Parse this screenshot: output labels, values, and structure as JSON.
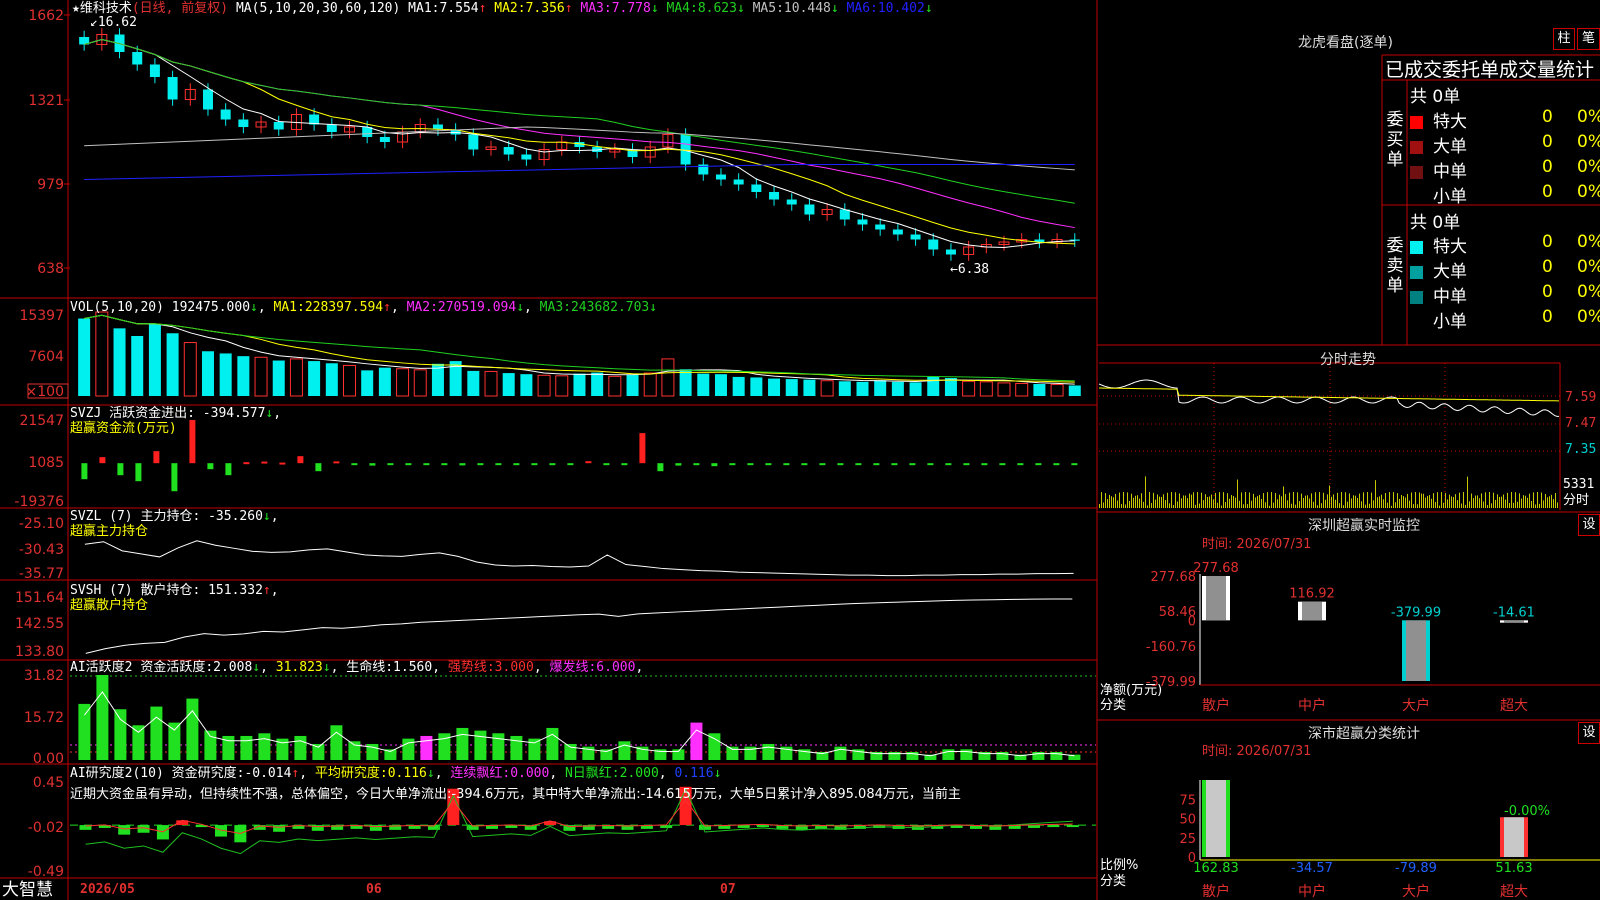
{
  "app": {
    "brand": "大智慧"
  },
  "colors": {
    "up": "#ff3030",
    "down": "#00f0f0",
    "flow_up": "#ff2020",
    "flow_down": "#20e020",
    "ma1": "#ffffff",
    "ma2": "#ffff00",
    "ma3": "#ff30ff",
    "ma4": "#20d020",
    "ma5": "#c0c0c0",
    "ma6": "#2020ff",
    "border": "#c00000"
  },
  "kline": {
    "stock_name": "★维科技术",
    "period": "(日线, 前复权)",
    "ma_params": "MA(5,10,20,30,60,120)",
    "ma": [
      {
        "label": "MA1:",
        "value": "7.554",
        "arrow": "↑"
      },
      {
        "label": "MA2:",
        "value": "7.356",
        "arrow": "↑"
      },
      {
        "label": "MA3:",
        "value": "7.778",
        "arrow": "↓"
      },
      {
        "label": "MA4:",
        "value": "8.623",
        "arrow": "↓"
      },
      {
        "label": "MA5:",
        "value": "10.448",
        "arrow": "↓"
      },
      {
        "label": "MA6:",
        "value": "10.402",
        "arrow": "↓"
      }
    ],
    "y_ticks": [
      "1662",
      "1321",
      "979",
      "638"
    ],
    "high_marker": "16.62",
    "low_marker": "6.38"
  },
  "vol": {
    "title": "VOL(5,10,20)",
    "value": "192475.000",
    "value_arrow": "↓",
    "ma": [
      {
        "label": "MA1:",
        "value": "228397.594",
        "arrow": "↑"
      },
      {
        "label": "MA2:",
        "value": "270519.094",
        "arrow": "↓"
      },
      {
        "label": "MA3:",
        "value": "243682.703",
        "arrow": "↓"
      }
    ],
    "y_ticks": [
      "15397",
      "7604",
      "×100"
    ]
  },
  "svzj": {
    "title": "SVZJ",
    "label": "活跃资金进出:",
    "value": "-394.577",
    "arrow": "↓",
    "subtitle": "超赢资金流(万元)",
    "y_ticks": [
      "21547",
      "1085",
      "-19376"
    ]
  },
  "svzl": {
    "title": "SVZL (7)",
    "label": "主力持仓:",
    "value": "-35.260",
    "arrow": "↓",
    "subtitle": "超赢主力持仓",
    "y_ticks": [
      "-25.10",
      "-30.43",
      "-35.77"
    ]
  },
  "svsh": {
    "title": "SVSH (7)",
    "label": "散户持仓:",
    "value": "151.332",
    "arrow": "↑",
    "subtitle": "超赢散户持仓",
    "y_ticks": [
      "151.64",
      "142.55",
      "133.80"
    ]
  },
  "ai_active": {
    "title": "AI活跃度2",
    "items": [
      {
        "label": "资金活跃度:",
        "value": "2.008",
        "arrow": "↓"
      },
      {
        "label": "",
        "value": "31.823",
        "arrow": "↓"
      },
      {
        "label": "生命线:",
        "value": "1.560",
        "arrow": ""
      },
      {
        "label": "强势线:",
        "value": "3.000",
        "arrow": ""
      },
      {
        "label": "爆发线:",
        "value": "6.000",
        "arrow": ""
      }
    ],
    "y_ticks": [
      "31.82",
      "15.72",
      "0.00"
    ]
  },
  "ai_research": {
    "title": "AI研究度2(10)",
    "items": [
      {
        "label": "资金研究度:",
        "value": "-0.014",
        "arrow": "↑"
      },
      {
        "label": "平均研究度:",
        "value": "0.116",
        "arrow": "↓"
      },
      {
        "label": "连续飘红:",
        "value": "0.000",
        "arrow": ""
      },
      {
        "label": "N日飘红:",
        "value": "2.000",
        "arrow": ""
      },
      {
        "label": "",
        "value": "0.116",
        "arrow": "↓"
      }
    ],
    "commentary": "近期大资金虽有异动，但持续性不强，总体偏空，今日大单净流出:-394.6万元，其中特大单净流出:-14.615万元，大单5日累计净入895.084万元，当前主",
    "y_ticks": [
      "0.45",
      "-0.02",
      "-0.49"
    ]
  },
  "date_axis": [
    "2026/05",
    "06",
    "07"
  ],
  "dragon_tiger": {
    "title": "龙虎看盘(逐单)",
    "buttons": [
      "柱",
      "笔"
    ],
    "header": "已成交委托单成交量统计",
    "buy": {
      "side_label": "委买单",
      "total": "共 0单",
      "rows": [
        {
          "name": "特大",
          "count": "0",
          "pct": "0%",
          "color": "#ff0000"
        },
        {
          "name": "大单",
          "count": "0",
          "pct": "0%",
          "color": "#a01010"
        },
        {
          "name": "中单",
          "count": "0",
          "pct": "0%",
          "color": "#701010"
        },
        {
          "name": "小单",
          "count": "0",
          "pct": "0%",
          "color": "#000000"
        }
      ]
    },
    "sell": {
      "side_label": "委卖单",
      "total": "共 0单",
      "rows": [
        {
          "name": "特大",
          "count": "0",
          "pct": "0%",
          "color": "#00f0f0"
        },
        {
          "name": "大单",
          "count": "0",
          "pct": "0%",
          "color": "#00a0a0"
        },
        {
          "name": "中单",
          "count": "0",
          "pct": "0%",
          "color": "#008080"
        },
        {
          "name": "小单",
          "count": "0",
          "pct": "0%",
          "color": "#000000"
        }
      ]
    }
  },
  "intraday": {
    "title": "分时走势",
    "y_ticks": [
      "7.59",
      "7.47",
      "7.35"
    ],
    "vol_tick": "5331",
    "vol_label": "分时"
  },
  "monitor": {
    "title": "深圳超赢实时监控",
    "settings": "设",
    "time": "时间: 2026/07/31",
    "axis_label_1": "净额(万元)",
    "axis_label_2": "分类",
    "y_ticks": [
      "277.68",
      "58.46",
      "0",
      "-160.76",
      "-379.99"
    ],
    "bars": [
      {
        "category": "散户",
        "value": 277.68,
        "label": "277.68"
      },
      {
        "category": "中户",
        "value": 116.92,
        "label": "116.92"
      },
      {
        "category": "大户",
        "value": -379.99,
        "label": "-379.99"
      },
      {
        "category": "超大",
        "value": -14.61,
        "label": "-14.61"
      }
    ]
  },
  "classify": {
    "title": "深市超赢分类统计",
    "settings": "设",
    "time": "时间: 2026/07/31",
    "axis_label_1": "比例%",
    "axis_label_2": "分类",
    "y_ticks": [
      "75",
      "50",
      "25",
      "0"
    ],
    "bars": [
      {
        "category": "散户",
        "value": 162.83,
        "label": "162.83"
      },
      {
        "category": "中户",
        "value": -34.57,
        "label": "-34.57"
      },
      {
        "category": "大户",
        "value": -79.89,
        "label": "-79.89"
      },
      {
        "category": "超大",
        "value": 51.63,
        "label": "51.63"
      }
    ],
    "top_label": "-0.00%"
  },
  "chart_data": [
    {
      "type": "candlestick",
      "title": "★维科技术 (日线, 前复权)",
      "x_range": [
        "2026/05",
        "2026/07"
      ],
      "ylim": [
        6.38,
        16.62
      ],
      "high": 16.62,
      "low": 6.38,
      "closes": [
        15.4,
        15.8,
        15.1,
        14.6,
        14.1,
        13.2,
        13.6,
        12.8,
        12.4,
        12.1,
        12.3,
        12.0,
        12.6,
        12.2,
        11.9,
        12.1,
        11.7,
        11.5,
        11.9,
        12.2,
        12.0,
        11.8,
        11.2,
        11.3,
        11.0,
        10.8,
        11.2,
        11.5,
        11.3,
        11.1,
        11.2,
        10.9,
        11.3,
        11.8,
        10.6,
        10.2,
        10.0,
        9.8,
        9.5,
        9.2,
        9.0,
        8.6,
        8.8,
        8.4,
        8.2,
        8.0,
        7.8,
        7.6,
        7.2,
        7.0,
        7.3,
        7.4,
        7.5,
        7.6,
        7.5,
        7.6,
        7.55
      ]
    },
    {
      "type": "bar",
      "title": "VOL(5,10,20)",
      "ylim": [
        0,
        15397
      ],
      "values": [
        14200,
        15397,
        12400,
        11000,
        13200,
        11500,
        9800,
        8200,
        7800,
        7300,
        7100,
        6500,
        6800,
        6400,
        6000,
        5600,
        4700,
        5200,
        5000,
        4800,
        5900,
        6400,
        4600,
        4500,
        4200,
        4000,
        3800,
        3700,
        4100,
        4300,
        3600,
        3900,
        4200,
        6800,
        4900,
        4100,
        4000,
        3500,
        3400,
        3200,
        3100,
        3000,
        2800,
        2700,
        2600,
        2900,
        2600,
        2500,
        3500,
        3300,
        2700,
        2600,
        2400,
        2300,
        2200,
        2100,
        1924.75
      ]
    },
    {
      "type": "bar",
      "title": "SVZJ 超赢资金流(万元)",
      "ylim": [
        -19376,
        21547
      ],
      "values": [
        -8000,
        3000,
        -6000,
        -9000,
        6000,
        -14000,
        21547,
        -3000,
        -6000,
        500,
        800,
        300,
        3500,
        -4000,
        900,
        -600,
        -1200,
        -800,
        -1000,
        -700,
        -900,
        -1100,
        -400,
        -700,
        -500,
        -300,
        -800,
        -600,
        1000,
        -500,
        -400,
        15000,
        -4000,
        -1200,
        -900,
        -1500,
        -600,
        -800,
        -700,
        -500,
        -600,
        -400,
        -300,
        -700,
        -500,
        -400,
        -300,
        -200,
        -500,
        -400,
        -300,
        -250,
        -300,
        -350,
        -400,
        -394.577
      ]
    },
    {
      "type": "line",
      "title": "SVZL (7) 超赢主力持仓",
      "ylim": [
        -35.77,
        -25.1
      ],
      "values": [
        -29.5,
        -29.0,
        -30.8,
        -31.4,
        -32.0,
        -30.2,
        -28.8,
        -29.7,
        -30.3,
        -30.9,
        -31.1,
        -31.0,
        -30.6,
        -30.4,
        -31.0,
        -31.6,
        -31.8,
        -31.9,
        -31.5,
        -31.2,
        -31.9,
        -33.0,
        -33.6,
        -33.8,
        -33.7,
        -33.9,
        -34.0,
        -33.8,
        -31.6,
        -33.5,
        -33.9,
        -34.3,
        -34.5,
        -34.7,
        -34.8,
        -35.0,
        -35.1,
        -35.2,
        -35.3,
        -35.4,
        -35.5,
        -35.6,
        -35.6,
        -35.7,
        -35.7,
        -35.6,
        -35.6,
        -35.5,
        -35.5,
        -35.4,
        -35.4,
        -35.3,
        -35.3,
        -35.26
      ]
    },
    {
      "type": "line",
      "title": "SVSH (7) 超赢散户持仓",
      "ylim": [
        133.8,
        151.64
      ],
      "values": [
        134.0,
        135.5,
        136.6,
        137.2,
        137.5,
        139.2,
        140.3,
        139.8,
        140.2,
        141.0,
        140.8,
        141.5,
        142.2,
        142.0,
        142.5,
        143.1,
        143.4,
        143.9,
        144.2,
        144.5,
        144.8,
        145.1,
        145.4,
        145.7,
        146.0,
        146.3,
        146.5,
        145.8,
        146.6,
        146.9,
        147.2,
        147.5,
        147.8,
        148.1,
        148.4,
        148.7,
        149.0,
        149.3,
        149.6,
        149.9,
        150.1,
        150.3,
        150.5,
        150.7,
        150.9,
        151.0,
        151.1,
        151.2,
        151.3,
        151.32,
        151.332
      ]
    },
    {
      "type": "bar",
      "title": "AI活跃度2",
      "ylim": [
        0,
        31.82
      ],
      "values": [
        21,
        31.82,
        19,
        13,
        20,
        14,
        23,
        11,
        9,
        9,
        10,
        8,
        9,
        6,
        13,
        7,
        6,
        4,
        8,
        9,
        10,
        12,
        11,
        10,
        9,
        8,
        12,
        6,
        5,
        4,
        7,
        5,
        4,
        4,
        14,
        10,
        5,
        5,
        6,
        5,
        4,
        3,
        5,
        4,
        3,
        3,
        3,
        2,
        4,
        4,
        3,
        3,
        2,
        3,
        3,
        2.008
      ]
    },
    {
      "type": "bar",
      "title": "AI研究度2(10)",
      "ylim": [
        -0.49,
        0.45
      ],
      "values": [
        -0.05,
        -0.03,
        -0.1,
        -0.08,
        -0.15,
        0.05,
        -0.02,
        -0.12,
        -0.18,
        -0.05,
        -0.07,
        -0.04,
        -0.06,
        -0.05,
        -0.04,
        -0.06,
        -0.05,
        -0.04,
        -0.05,
        0.38,
        -0.05,
        -0.04,
        -0.03,
        -0.05,
        0.04,
        -0.06,
        -0.05,
        -0.04,
        -0.05,
        -0.04,
        -0.03,
        0.4,
        -0.05,
        -0.04,
        -0.03,
        -0.02,
        -0.04,
        -0.05,
        -0.04,
        -0.05,
        -0.04,
        -0.03,
        -0.04,
        -0.05,
        -0.04,
        -0.03,
        -0.04,
        -0.05,
        -0.04,
        -0.03,
        -0.02,
        -0.014
      ]
    }
  ]
}
